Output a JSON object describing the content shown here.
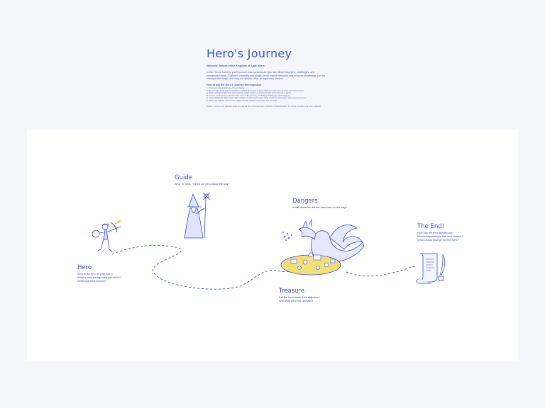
{
  "intro": {
    "title": "Hero's Journey",
    "welcome": "Welcome, heroes of the Kingdom of Agile-Years!",
    "description_1": "In the Hero's Journey, you'll recount your sprint as an epic tale. Share triumphs, challenges, and",
    "description_2": "unexpected twists. Embrace creativity and magic as we inspire reflection and uncover knowledge. Let the",
    "description_3": "retrospective begin, and may our stories strive as legendary heroes!",
    "howto_title": "How to use the Hero's Journey Retrospective",
    "steps": [
      "1. Introduce the activity and the purpose",
      "2. Encourage each team member to reflect and think of themselves as the hero of their own sprint story",
      "3. Each person writes their elements on each section, using prompts and icons as a guide",
      "4. In turn, each person shares their part of the journey, including challenges and dangers",
      "5. Once all stories have been told, reflect on what went well, what could be improved, and lessons learned",
      "6. After you reflect, vote on the ideas, decide actions and close the session"
    ],
    "bonus": "Bonus - at the end, ask the team to vote for the \"funniest hero\" and the \"bravest hero\". Or come up with your own awards!"
  },
  "sections": {
    "hero": {
      "title": "Hero",
      "questions": [
        "Who is the hero of your story?",
        "What is their background and skills?",
        "What was their mission?"
      ]
    },
    "guide": {
      "title": "Guide",
      "questions": [
        "Who, or what, helped our hero along the way?"
      ]
    },
    "dangers": {
      "title": "Dangers",
      "questions": [
        "What obstacles did our hero face on the way?"
      ]
    },
    "treasure": {
      "title": "Treasure",
      "questions": [
        "Did the hero reach their objective?",
        "And what were the rewards?"
      ]
    },
    "end": {
      "title": "The End!",
      "questions": [
        "How has the hero levelled up?",
        "What's happening in the next chapter?",
        "What should change for next time?"
      ]
    }
  },
  "colors": {
    "ink": "#3a4fc9",
    "accent": "#e8c73a",
    "background": "#f5f6fb",
    "board": "#ffffff"
  },
  "icons": [
    "hero-illustration",
    "wizard-illustration",
    "dragon-illustration",
    "treasure-illustration",
    "scroll-illustration"
  ]
}
